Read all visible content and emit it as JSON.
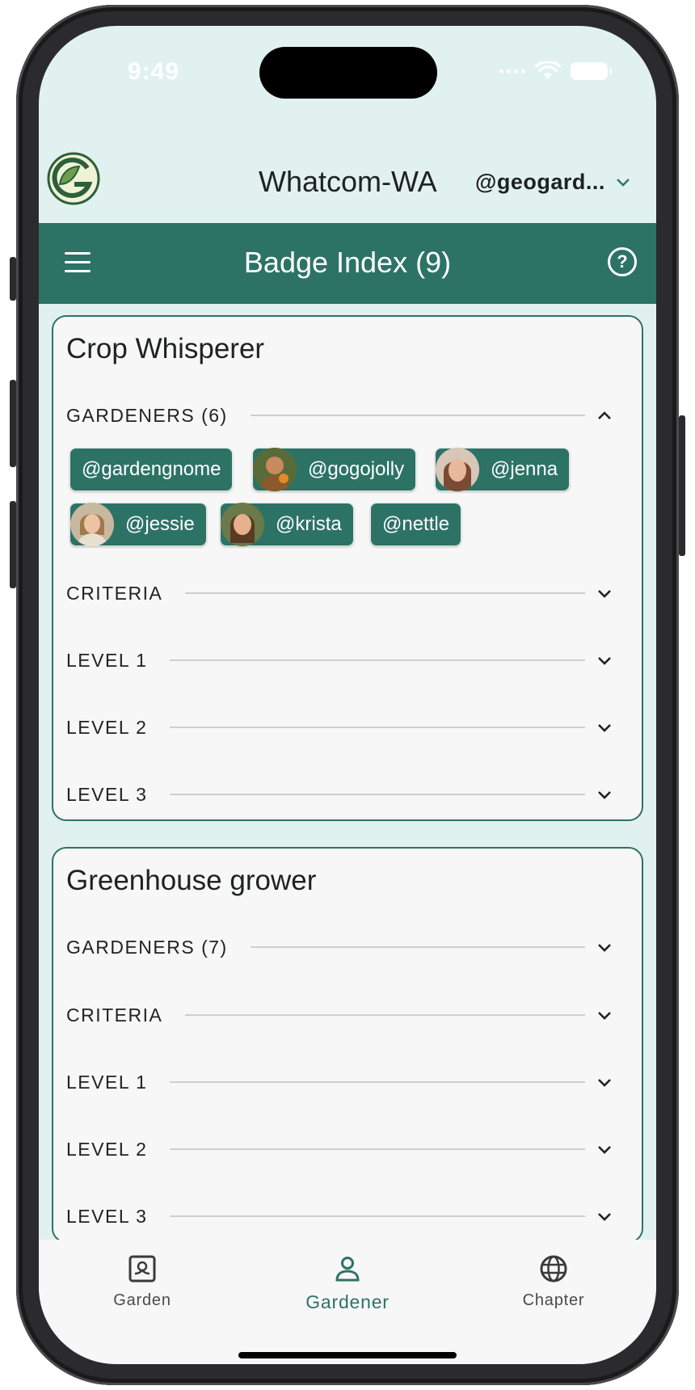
{
  "status_bar": {
    "time": "9:49"
  },
  "header": {
    "chapter_title": "Whatcom-WA",
    "username": "@geogard..."
  },
  "title_bar": {
    "title": "Badge Index (9)"
  },
  "badges": [
    {
      "title": "Crop Whisperer",
      "sections": [
        {
          "label": "GARDENERS  (6)",
          "expanded": true
        },
        {
          "label": "CRITERIA",
          "expanded": false
        },
        {
          "label": "LEVEL 1",
          "expanded": false
        },
        {
          "label": "LEVEL 2",
          "expanded": false
        },
        {
          "label": "LEVEL 3",
          "expanded": false
        }
      ],
      "gardeners": [
        {
          "handle": "@gardengnome",
          "has_avatar": false
        },
        {
          "handle": "@gogojolly",
          "has_avatar": true
        },
        {
          "handle": "@jenna",
          "has_avatar": true
        },
        {
          "handle": "@jessie",
          "has_avatar": true
        },
        {
          "handle": "@krista",
          "has_avatar": true
        },
        {
          "handle": "@nettle",
          "has_avatar": false
        }
      ]
    },
    {
      "title": "Greenhouse grower",
      "sections": [
        {
          "label": "GARDENERS  (7)",
          "expanded": false
        },
        {
          "label": "CRITERIA",
          "expanded": false
        },
        {
          "label": "LEVEL 1",
          "expanded": false
        },
        {
          "label": "LEVEL 2",
          "expanded": false
        },
        {
          "label": "LEVEL 3",
          "expanded": false
        }
      ]
    }
  ],
  "bottom_nav": [
    {
      "label": "Garden",
      "icon": "garden-icon",
      "active": false
    },
    {
      "label": "Gardener",
      "icon": "person-icon",
      "active": true
    },
    {
      "label": "Chapter",
      "icon": "globe-icon",
      "active": false
    }
  ],
  "colors": {
    "primary": "#2c7366",
    "background": "#e1f1f0",
    "card": "#f7f7f7"
  }
}
